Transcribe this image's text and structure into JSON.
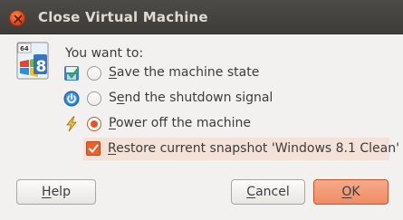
{
  "window": {
    "title": "Close Virtual Machine"
  },
  "logo": {
    "badge_text": "64",
    "digit_text": "8",
    "icon": "windows-8-vm-logo-icon"
  },
  "prompt": "You want to:",
  "options": [
    {
      "label_u": "S",
      "label_rest": "ave the machine state",
      "icon": "save-state-icon",
      "checked": false
    },
    {
      "label_pre": "S",
      "label_u": "e",
      "label_rest": "nd the shutdown signal",
      "icon": "power-button-icon",
      "checked": false
    },
    {
      "label_u": "P",
      "label_rest": "ower off the machine",
      "icon": "lightning-icon",
      "checked": true
    }
  ],
  "snapshot": {
    "label_u": "R",
    "label_rest": "estore current snapshot 'Windows 8.1 Clean'",
    "checked": true
  },
  "buttons": {
    "help_u": "H",
    "help_rest": "elp",
    "cancel_u": "C",
    "cancel_rest": "ancel",
    "ok_u": "O",
    "ok_rest": "K"
  },
  "colors": {
    "accent": "#e95420",
    "titlebar": "#3d3c38",
    "highlight_row": "#f4e2d9"
  }
}
